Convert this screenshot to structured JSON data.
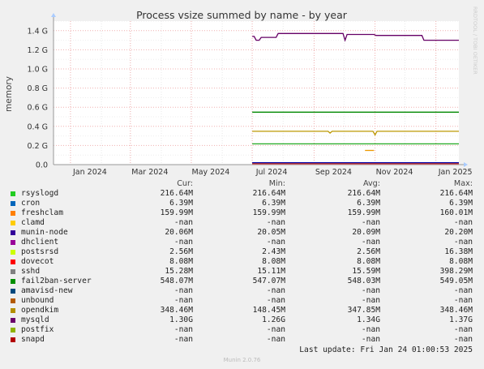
{
  "chart_data": {
    "type": "line",
    "title": "Process vsize summed by name - by year",
    "ylabel": "memory",
    "side_label": "RRDTOOL / TOBI OETIKER",
    "x_ticks": [
      "Jan 2024",
      "Mar 2024",
      "May 2024",
      "Jul 2024",
      "Sep 2024",
      "Nov 2024",
      "Jan 2025"
    ],
    "x_range": [
      "2023-12-15",
      "2025-01-24"
    ],
    "y_ticks": [
      "0.0",
      "0.2 G",
      "0.4 G",
      "0.6 G",
      "0.8 G",
      "1.0 G",
      "1.2 G",
      "1.4 G"
    ],
    "ylim": [
      0,
      1.5
    ],
    "grid": true,
    "series": [
      {
        "name": "mysqld",
        "color": "#660066",
        "points": [
          [
            "2024-07-01",
            1.34
          ],
          [
            "2024-07-03",
            1.34
          ],
          [
            "2024-07-05",
            1.3
          ],
          [
            "2024-07-08",
            1.3
          ],
          [
            "2024-07-10",
            1.33
          ],
          [
            "2024-07-25",
            1.33
          ],
          [
            "2024-07-27",
            1.37
          ],
          [
            "2024-09-30",
            1.37
          ],
          [
            "2024-10-02",
            1.3
          ],
          [
            "2024-10-04",
            1.36
          ],
          [
            "2024-10-31",
            1.36
          ],
          [
            "2024-11-02",
            1.35
          ],
          [
            "2024-12-18",
            1.35
          ],
          [
            "2024-12-20",
            1.3
          ],
          [
            "2025-01-24",
            1.3
          ]
        ]
      },
      {
        "name": "fail2ban-server",
        "color": "#008800",
        "points": [
          [
            "2024-07-01",
            0.548
          ],
          [
            "2025-01-24",
            0.548
          ]
        ]
      },
      {
        "name": "opendkim",
        "color": "#bb9900",
        "points": [
          [
            "2024-07-01",
            0.348
          ],
          [
            "2024-09-15",
            0.348
          ],
          [
            "2024-09-17",
            0.33
          ],
          [
            "2024-09-19",
            0.348
          ],
          [
            "2024-10-30",
            0.348
          ],
          [
            "2024-11-01",
            0.31
          ],
          [
            "2024-11-03",
            0.348
          ],
          [
            "2025-01-24",
            0.348
          ]
        ]
      },
      {
        "name": "opendkim-gap",
        "color": "#ee9900",
        "points": [
          [
            "2024-10-22",
            0.148
          ],
          [
            "2024-10-31",
            0.148
          ]
        ]
      },
      {
        "name": "rsyslogd",
        "color": "#22aa22",
        "points": [
          [
            "2024-07-01",
            0.2166
          ],
          [
            "2025-01-24",
            0.2166
          ]
        ]
      },
      {
        "name": "sshd",
        "color": "#117744",
        "points": [
          [
            "2024-07-01",
            0.0153
          ],
          [
            "2025-01-24",
            0.0153
          ]
        ]
      },
      {
        "name": "munin-node",
        "color": "#0000aa",
        "points": [
          [
            "2024-07-01",
            0.0201
          ],
          [
            "2025-01-24",
            0.0201
          ]
        ]
      },
      {
        "name": "dovecot",
        "color": "#ee2222",
        "points": [
          [
            "2024-07-01",
            0.0081
          ],
          [
            "2025-01-24",
            0.0081
          ]
        ]
      }
    ]
  },
  "legend": {
    "headers": {
      "cur": "Cur:",
      "min": "Min:",
      "avg": "Avg:",
      "max": "Max:"
    },
    "rows": [
      {
        "name": "rsyslogd",
        "color": "#22cc22",
        "cur": "216.64M",
        "min": "216.64M",
        "avg": "216.64M",
        "max": "216.64M"
      },
      {
        "name": "cron",
        "color": "#0066bb",
        "cur": "6.39M",
        "min": "6.39M",
        "avg": "6.39M",
        "max": "6.39M"
      },
      {
        "name": "freshclam",
        "color": "#ff7f00",
        "cur": "159.99M",
        "min": "159.99M",
        "avg": "159.99M",
        "max": "160.01M"
      },
      {
        "name": "clamd",
        "color": "#ffcc00",
        "cur": "-nan",
        "min": "-nan",
        "avg": "-nan",
        "max": "-nan"
      },
      {
        "name": "munin-node",
        "color": "#330099",
        "cur": "20.06M",
        "min": "20.05M",
        "avg": "20.09M",
        "max": "20.20M"
      },
      {
        "name": "dhclient",
        "color": "#990099",
        "cur": "-nan",
        "min": "-nan",
        "avg": "-nan",
        "max": "-nan"
      },
      {
        "name": "postsrsd",
        "color": "#ccff00",
        "cur": "2.56M",
        "min": "2.43M",
        "avg": "2.56M",
        "max": "16.38M"
      },
      {
        "name": "dovecot",
        "color": "#ff0000",
        "cur": "8.08M",
        "min": "8.08M",
        "avg": "8.08M",
        "max": "8.08M"
      },
      {
        "name": "sshd",
        "color": "#808080",
        "cur": "15.28M",
        "min": "15.11M",
        "avg": "15.59M",
        "max": "398.29M"
      },
      {
        "name": "fail2ban-server",
        "color": "#008f00",
        "cur": "548.07M",
        "min": "547.07M",
        "avg": "548.03M",
        "max": "549.05M"
      },
      {
        "name": "amavisd-new",
        "color": "#00487d",
        "cur": "-nan",
        "min": "-nan",
        "avg": "-nan",
        "max": "-nan"
      },
      {
        "name": "unbound",
        "color": "#b35a00",
        "cur": "-nan",
        "min": "-nan",
        "avg": "-nan",
        "max": "-nan"
      },
      {
        "name": "opendkim",
        "color": "#b38f00",
        "cur": "348.46M",
        "min": "148.45M",
        "avg": "347.85M",
        "max": "348.46M"
      },
      {
        "name": "mysqld",
        "color": "#6b006b",
        "cur": "1.30G",
        "min": "1.26G",
        "avg": "1.34G",
        "max": "1.37G"
      },
      {
        "name": "postfix",
        "color": "#8fb300",
        "cur": "-nan",
        "min": "-nan",
        "avg": "-nan",
        "max": "-nan"
      },
      {
        "name": "snapd",
        "color": "#b30000",
        "cur": "-nan",
        "min": "-nan",
        "avg": "-nan",
        "max": "-nan"
      }
    ]
  },
  "footer": {
    "last_update": "Last update: Fri Jan 24 01:00:53 2025",
    "version": "Munin 2.0.76"
  }
}
